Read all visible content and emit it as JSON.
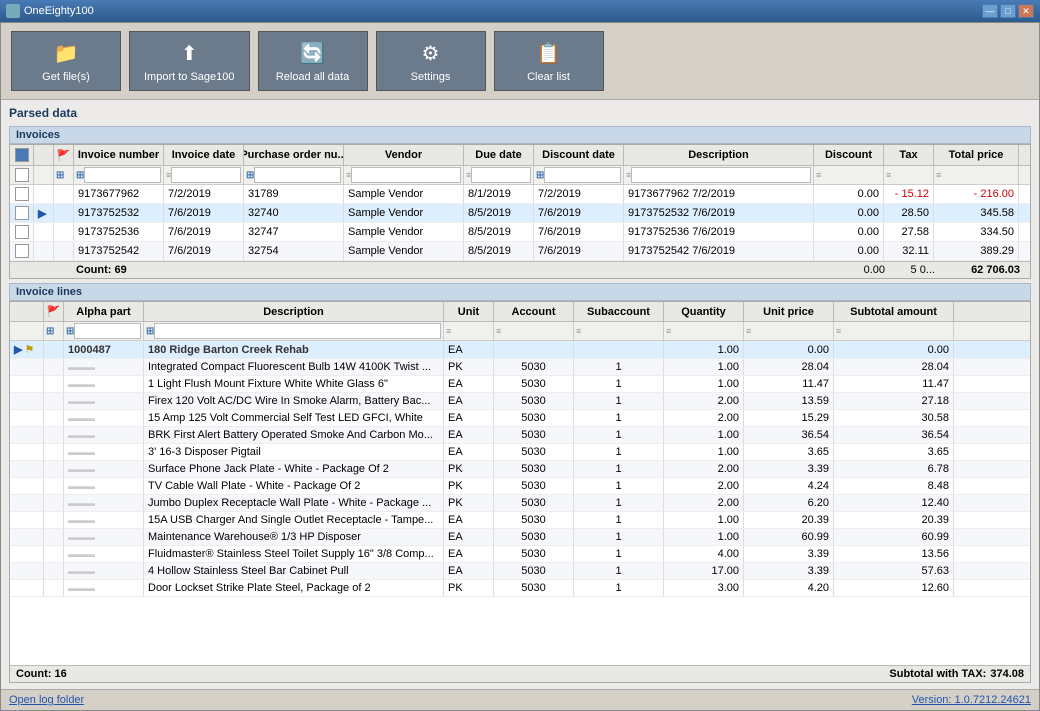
{
  "titleBar": {
    "appName": "OneEighty100",
    "controls": [
      "—",
      "□",
      "✕"
    ]
  },
  "toolbar": {
    "buttons": [
      {
        "id": "get-files",
        "label": "Get file(s)",
        "icon": "📁"
      },
      {
        "id": "import-sage",
        "label": "Import to Sage100",
        "icon": "⬆"
      },
      {
        "id": "reload",
        "label": "Reload all data",
        "icon": "🔄"
      },
      {
        "id": "settings",
        "label": "Settings",
        "icon": "⚙"
      },
      {
        "id": "clear",
        "label": "Clear list",
        "icon": "📋"
      }
    ]
  },
  "parsedDataLabel": "Parsed data",
  "invoicesSection": {
    "label": "Invoices",
    "columns": [
      {
        "id": "check",
        "label": ""
      },
      {
        "id": "flag",
        "label": "🚩"
      },
      {
        "id": "invoice-number",
        "label": "Invoice number"
      },
      {
        "id": "invoice-date",
        "label": "Invoice date"
      },
      {
        "id": "po-number",
        "label": "Purchase order nu..."
      },
      {
        "id": "vendor",
        "label": "Vendor"
      },
      {
        "id": "due-date",
        "label": "Due date"
      },
      {
        "id": "discount-date",
        "label": "Discount date"
      },
      {
        "id": "description",
        "label": "Description"
      },
      {
        "id": "discount",
        "label": "Discount"
      },
      {
        "id": "tax",
        "label": "Tax"
      },
      {
        "id": "total-price",
        "label": "Total price"
      }
    ],
    "rows": [
      {
        "check": false,
        "flag": false,
        "invoiceNum": "9173677962",
        "invoiceDate": "7/2/2019",
        "poNum": "31789",
        "vendor": "Sample Vendor",
        "dueDate": "8/1/2019",
        "discountDate": "7/2/2019",
        "description": "9173677962 7/2/2019",
        "discount": "0.00",
        "tax": "- 15.12",
        "total": "- 216.00",
        "selected": false
      },
      {
        "check": false,
        "flag": false,
        "invoiceNum": "9173752532",
        "invoiceDate": "7/6/2019",
        "poNum": "32740",
        "vendor": "Sample Vendor",
        "dueDate": "8/5/2019",
        "discountDate": "7/6/2019",
        "description": "9173752532 7/6/2019",
        "discount": "0.00",
        "tax": "28.50",
        "total": "345.58",
        "selected": true,
        "active": true
      },
      {
        "check": false,
        "flag": false,
        "invoiceNum": "9173752536",
        "invoiceDate": "7/6/2019",
        "poNum": "32747",
        "vendor": "Sample Vendor",
        "dueDate": "8/5/2019",
        "discountDate": "7/6/2019",
        "description": "9173752536 7/6/2019",
        "discount": "0.00",
        "tax": "27.58",
        "total": "334.50",
        "selected": false
      },
      {
        "check": false,
        "flag": false,
        "invoiceNum": "9173752542",
        "invoiceDate": "7/6/2019",
        "poNum": "32754",
        "vendor": "Sample Vendor",
        "dueDate": "8/5/2019",
        "discountDate": "7/6/2019",
        "description": "9173752542 7/6/2019",
        "discount": "0.00",
        "tax": "32.11",
        "total": "389.29",
        "selected": false
      }
    ],
    "footer": {
      "count": "Count: 69",
      "discount": "0.00",
      "tax": "5 0...",
      "total": "62 706.03"
    }
  },
  "invoiceLinesSection": {
    "label": "Invoice lines",
    "columns": [
      {
        "id": "flag",
        "label": "🚩"
      },
      {
        "id": "alpha-part",
        "label": "Alpha part"
      },
      {
        "id": "description",
        "label": "Description"
      },
      {
        "id": "unit",
        "label": "Unit"
      },
      {
        "id": "account",
        "label": "Account"
      },
      {
        "id": "subaccount",
        "label": "Subaccount"
      },
      {
        "id": "quantity",
        "label": "Quantity"
      },
      {
        "id": "unit-price",
        "label": "Unit price"
      },
      {
        "id": "subtotal",
        "label": "Subtotal amount"
      }
    ],
    "rows": [
      {
        "alphaPart": "1000487",
        "description": "180 Ridge Barton Creek Rehab",
        "unit": "EA",
        "account": "",
        "subaccount": "",
        "qty": "1.00",
        "unitPrice": "0.00",
        "subtotal": "0.00",
        "isHeader": true
      },
      {
        "alphaPart": "",
        "description": "Integrated Compact Fluorescent Bulb 14W 4100K Twist ...",
        "unit": "PK",
        "account": "5030",
        "subaccount": "1",
        "qty": "1.00",
        "unitPrice": "28.04",
        "subtotal": "28.04"
      },
      {
        "alphaPart": "",
        "description": "1 Light Flush Mount Fixture White White Glass 6\"",
        "unit": "EA",
        "account": "5030",
        "subaccount": "1",
        "qty": "1.00",
        "unitPrice": "11.47",
        "subtotal": "11.47"
      },
      {
        "alphaPart": "",
        "description": "Firex 120 Volt AC/DC Wire In Smoke Alarm, Battery Bac...",
        "unit": "EA",
        "account": "5030",
        "subaccount": "1",
        "qty": "2.00",
        "unitPrice": "13.59",
        "subtotal": "27.18"
      },
      {
        "alphaPart": "",
        "description": "15 Amp 125 Volt Commercial Self Test LED GFCI, White",
        "unit": "EA",
        "account": "5030",
        "subaccount": "1",
        "qty": "2.00",
        "unitPrice": "15.29",
        "subtotal": "30.58"
      },
      {
        "alphaPart": "",
        "description": "BRK First Alert Battery Operated Smoke And Carbon Mo...",
        "unit": "EA",
        "account": "5030",
        "subaccount": "1",
        "qty": "1.00",
        "unitPrice": "36.54",
        "subtotal": "36.54"
      },
      {
        "alphaPart": "",
        "description": "3' 16-3 Disposer Pigtail",
        "unit": "EA",
        "account": "5030",
        "subaccount": "1",
        "qty": "1.00",
        "unitPrice": "3.65",
        "subtotal": "3.65"
      },
      {
        "alphaPart": "",
        "description": "Surface Phone Jack Plate - White - Package Of 2",
        "unit": "PK",
        "account": "5030",
        "subaccount": "1",
        "qty": "2.00",
        "unitPrice": "3.39",
        "subtotal": "6.78"
      },
      {
        "alphaPart": "",
        "description": "TV Cable Wall Plate - White - Package Of 2",
        "unit": "PK",
        "account": "5030",
        "subaccount": "1",
        "qty": "2.00",
        "unitPrice": "4.24",
        "subtotal": "8.48"
      },
      {
        "alphaPart": "",
        "description": "Jumbo Duplex Receptacle Wall Plate - White - Package ...",
        "unit": "PK",
        "account": "5030",
        "subaccount": "1",
        "qty": "2.00",
        "unitPrice": "6.20",
        "subtotal": "12.40"
      },
      {
        "alphaPart": "",
        "description": "15A USB Charger And Single Outlet Receptacle - Tampe...",
        "unit": "EA",
        "account": "5030",
        "subaccount": "1",
        "qty": "1.00",
        "unitPrice": "20.39",
        "subtotal": "20.39"
      },
      {
        "alphaPart": "",
        "description": "Maintenance Warehouse® 1/3 HP Disposer",
        "unit": "EA",
        "account": "5030",
        "subaccount": "1",
        "qty": "1.00",
        "unitPrice": "60.99",
        "subtotal": "60.99"
      },
      {
        "alphaPart": "",
        "description": "Fluidmaster® Stainless Steel Toilet Supply 16\" 3/8 Comp...",
        "unit": "EA",
        "account": "5030",
        "subaccount": "1",
        "qty": "4.00",
        "unitPrice": "3.39",
        "subtotal": "13.56"
      },
      {
        "alphaPart": "",
        "description": "4 Hollow Stainless Steel Bar Cabinet Pull",
        "unit": "EA",
        "account": "5030",
        "subaccount": "1",
        "qty": "17.00",
        "unitPrice": "3.39",
        "subtotal": "57.63"
      },
      {
        "alphaPart": "",
        "description": "Door Lockset Strike Plate Steel, Package of 2",
        "unit": "PK",
        "account": "5030",
        "subaccount": "1",
        "qty": "3.00",
        "unitPrice": "4.20",
        "subtotal": "12.60"
      }
    ],
    "footer": {
      "count": "Count: 16",
      "subtotalLabel": "Subtotal with TAX:",
      "subtotalValue": "374.08"
    }
  },
  "bottomBar": {
    "logLink": "Open log folder",
    "version": "Version: 1.0.7212.24621"
  }
}
